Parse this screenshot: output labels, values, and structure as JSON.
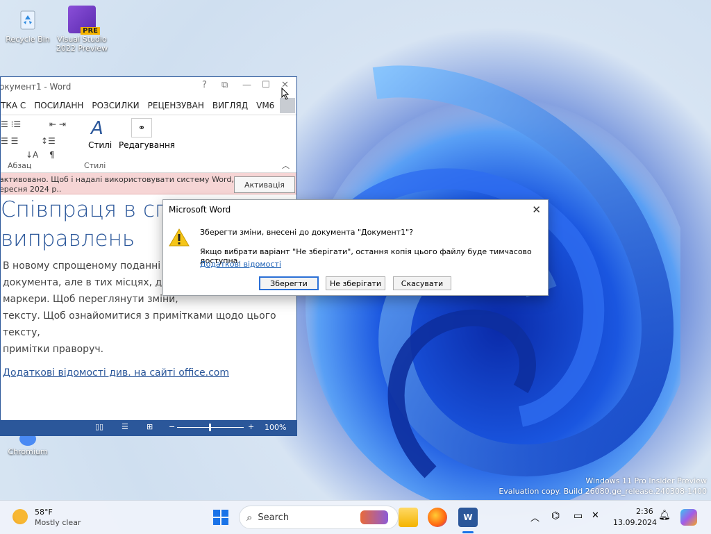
{
  "desktop": {
    "icons": [
      {
        "label": "Recycle Bin"
      },
      {
        "label": "Visual Studio 2022 Preview",
        "badge": "PRE"
      },
      {
        "label": "Chromium"
      }
    ],
    "watermark": {
      "line1": "Windows 11 Pro Insider Preview",
      "line2": "Evaluation copy. Build 26080.ge_release.240308-1400"
    }
  },
  "word": {
    "title": "окумент1 - Word",
    "title_controls": [
      "?",
      "⧉",
      "—",
      "☐",
      "✕"
    ],
    "tabs": [
      "ТКА С",
      "ПОСИЛАНН",
      "РОЗСИЛКИ",
      "РЕЦЕНЗУВАН",
      "ВИГЛЯД",
      "VM6"
    ],
    "groups": {
      "paragraph": "Абзац",
      "styles": "Стилі",
      "styles_button": "Стилі",
      "editing": "Редагування"
    },
    "activation": {
      "line1": "активовано. Щоб і надалі використовувати систему Word,",
      "line2": "ересня 2024 р..",
      "button": "Активація"
    },
    "doc": {
      "heading1": "Співпраця в спр",
      "heading2": "виправлень",
      "lines": [
        "В новому спрощеному поданні ви",
        "документа, але в тих місцях, де бу",
        "маркери. Щоб переглянути зміни,",
        "тексту. Щоб ознайомитися з примітками щодо цього тексту,",
        "примітки праворуч."
      ],
      "link": "Додаткові відомості див. на сайті office.com"
    },
    "status": {
      "zoom_minus": "−",
      "zoom_plus": "+",
      "zoom": "100%"
    }
  },
  "dialog": {
    "title": "Microsoft Word",
    "close": "✕",
    "message": "Зберегти зміни, внесені до документа \"Документ1\"?",
    "detail": "Якщо вибрати варіант \"Не зберігати\", остання копія цього файлу буде тимчасово доступна.",
    "more_info": "Додаткові відомості",
    "buttons": {
      "save": "Зберегти",
      "dont_save": "Не зберігати",
      "cancel": "Скасувати"
    }
  },
  "taskbar": {
    "weather_temp": "58°F",
    "weather_desc": "Mostly clear",
    "search_placeholder": "Search",
    "time": "2:36",
    "date": "13.09.2024"
  }
}
